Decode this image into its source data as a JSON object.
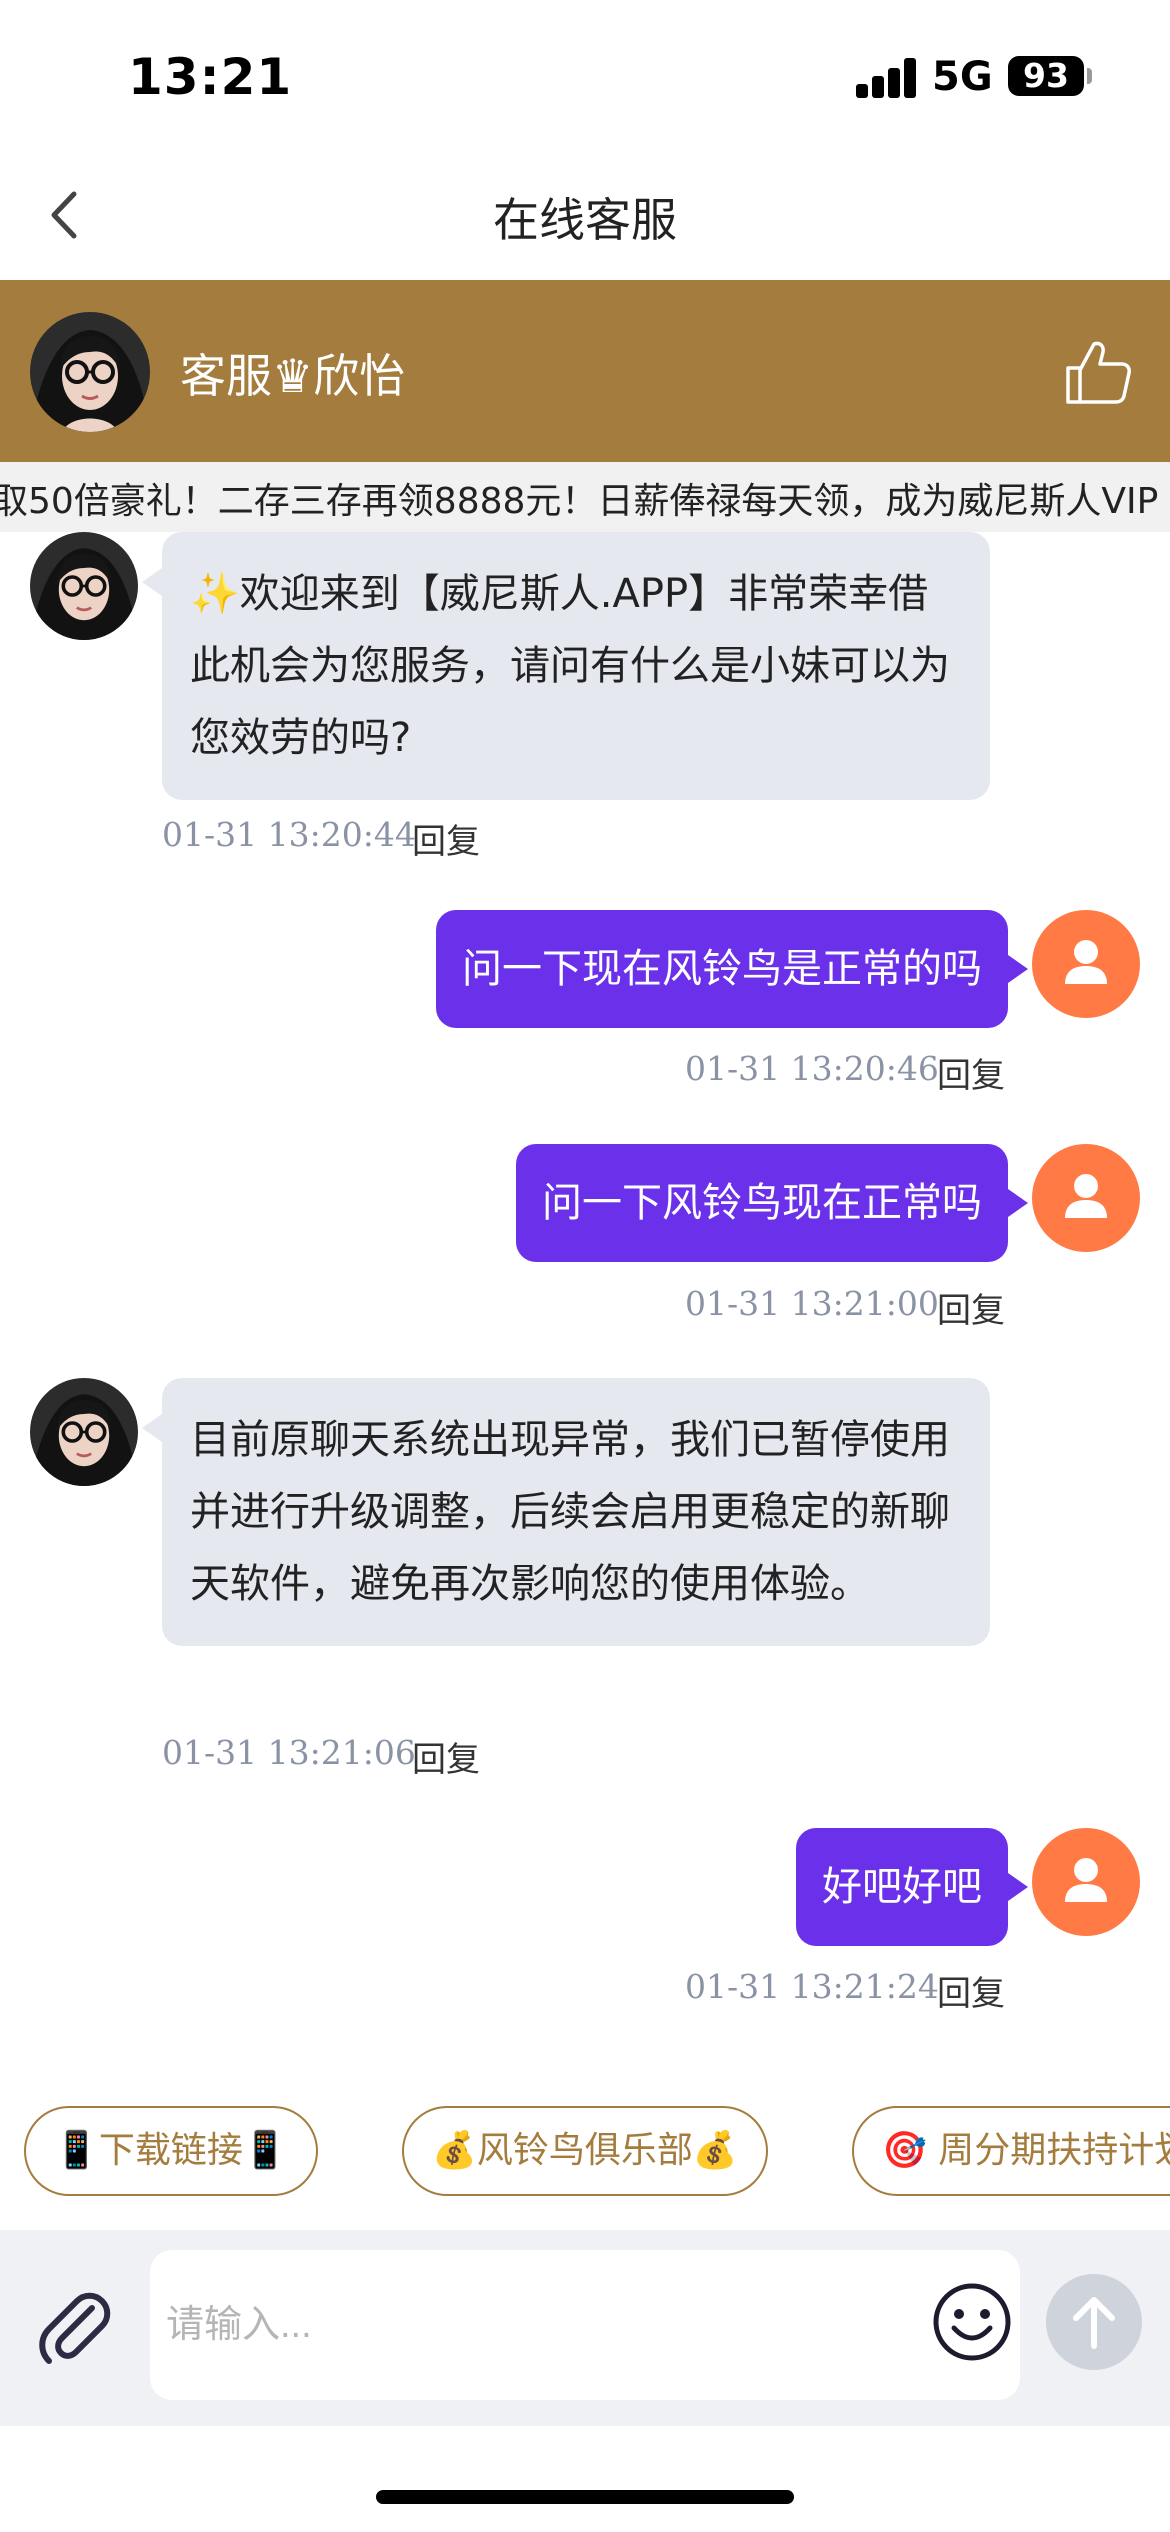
{
  "status_bar": {
    "time": "13:21",
    "network": "5G",
    "battery": "93"
  },
  "nav": {
    "title": "在线客服"
  },
  "agent": {
    "name": "客服♛欣怡"
  },
  "marquee": {
    "text": "取50倍豪礼！二存三存再领8888元！日薪俸禄每天领，成为威尼斯人VIP"
  },
  "messages": [
    {
      "from": "agent",
      "text": "✨欢迎来到【威尼斯人.APP】非常荣幸借此机会为您服务，请问有什么是小妹可以为您效劳的吗?",
      "time": "01-31 13:20:44",
      "reply": "回复"
    },
    {
      "from": "user",
      "text": "问一下现在风铃鸟是正常的吗",
      "time": "01-31 13:20:46",
      "reply": "回复"
    },
    {
      "from": "user",
      "text": "问一下风铃鸟现在正常吗",
      "time": "01-31 13:21:00",
      "reply": "回复"
    },
    {
      "from": "agent",
      "text": "目前原聊天系统出现异常，我们已暂停使用并进行升级调整，后续会启用更稳定的新聊天软件，避免再次影响您的使用体验。",
      "time": "01-31 13:21:06",
      "reply": "回复"
    },
    {
      "from": "user",
      "text": "好吧好吧",
      "time": "01-31 13:21:24",
      "reply": "回复"
    }
  ],
  "quick_actions": [
    {
      "label": "📱下载链接📱"
    },
    {
      "label": "💰风铃鸟俱乐部💰"
    },
    {
      "label": "🎯 周分期扶持计划"
    }
  ],
  "input": {
    "placeholder": "请输入..."
  },
  "colors": {
    "brand_gold": "#a47c3d",
    "user_bubble": "#6a30ea",
    "user_avatar": "#ff7a45",
    "agent_bubble": "#e5e8ef"
  },
  "icons": {
    "back": "chevron-left-icon",
    "like": "thumbs-up-icon",
    "attach": "paperclip-icon",
    "emoji": "smiley-icon",
    "send": "arrow-up-icon",
    "user": "person-icon"
  }
}
